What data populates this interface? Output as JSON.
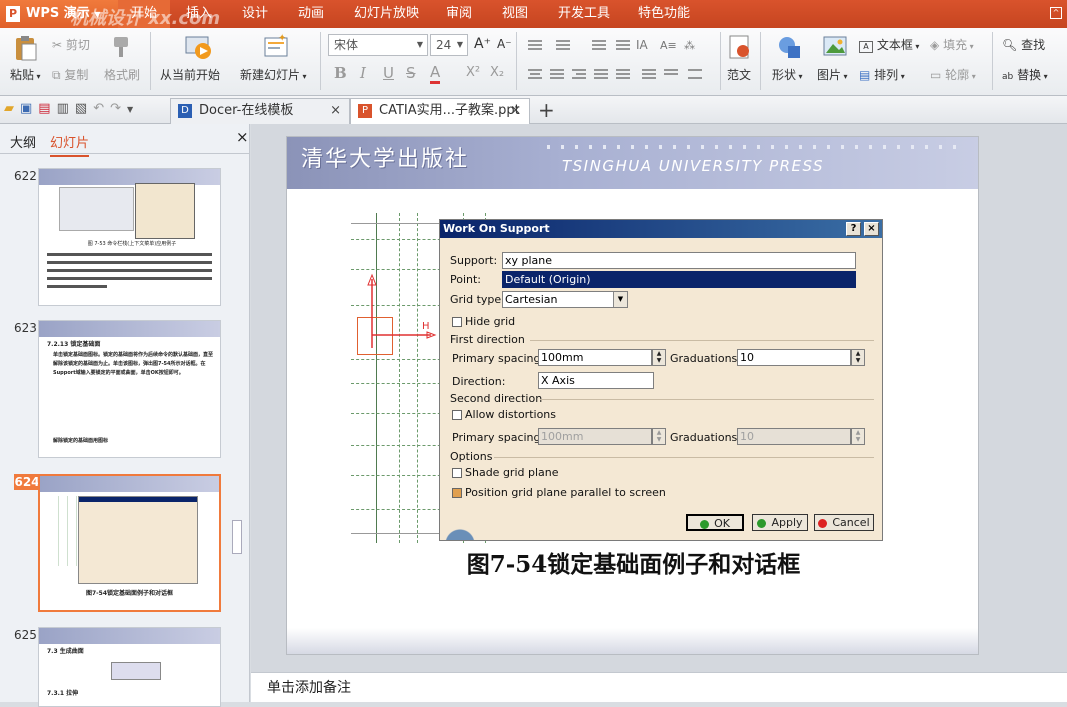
{
  "menubar": {
    "app_button": "WPS 演示",
    "watermark": "机械设计 xx.com",
    "tabs": [
      "开始",
      "插入",
      "设计",
      "动画",
      "幻灯片放映",
      "审阅",
      "视图",
      "开发工具",
      "特色功能"
    ]
  },
  "ribbon": {
    "paste": "粘贴",
    "cut": "剪切",
    "copy": "复制",
    "format_painter": "格式刷",
    "from_current": "从当前开始",
    "new_slide": "新建幻灯片",
    "font_name": "宋体",
    "font_size": "24",
    "font_grow": "A⁺",
    "font_shrink": "A⁻",
    "bold": "B",
    "italic": "I",
    "underline": "U",
    "strike": "S",
    "font_color": "A",
    "superscript": "X²",
    "subscript": "X₂",
    "template": "范文",
    "shape": "形状",
    "picture": "图片",
    "textbox": "文本框",
    "arrange": "排列",
    "fill": "填充",
    "outline": "轮廓",
    "find": "查找",
    "replace": "替换"
  },
  "doctabs": {
    "tab1": "Docer-在线模板",
    "tab2": "CATIA实用...子教案.ppt",
    "close": "×",
    "add": "+"
  },
  "leftpanel": {
    "tab_outline": "大纲",
    "tab_slides": "幻灯片",
    "close": "×",
    "slides": [
      {
        "num": "622",
        "caption": "图 7-53 命令栏栈(上下文菜单)应用例子"
      },
      {
        "num": "623",
        "heading": "7.2.13 锁定基础面",
        "body": "单击锁定基础面图标。锁定的基础面将作为后续命令的默认基础面，直至解除该锁定的基础面为止。单击该图标，弹出图7-54所示对话框。在Support域输入要锁定的平面或曲面，单击OK按钮即可。",
        "tail": "解除锁定的基础面用图标"
      },
      {
        "num": "624",
        "caption": "图7-54锁定基础面例子和对话框"
      },
      {
        "num": "625",
        "heading": "7.3 生成曲面",
        "sub": "7.3.1 拉伸"
      }
    ]
  },
  "slide": {
    "banner_cn": "清华大学出版社",
    "banner_en": "TSINGHUA UNIVERSITY PRESS",
    "caption": "图7-54锁定基础面例子和对话框",
    "axis_label": "H"
  },
  "dialog": {
    "title": "Work On Support",
    "help": "?",
    "close": "×",
    "support_label": "Support:",
    "support_value": "xy plane",
    "point_label": "Point:",
    "point_value": "Default (Origin)",
    "grid_type_label": "Grid type:",
    "grid_type_value": "Cartesian",
    "hide_grid": "Hide grid",
    "first_direction": "First direction",
    "primary_spacing_label": "Primary spacing:",
    "primary_spacing_1": "100mm",
    "graduations_label": "Graduations:",
    "graduations_1": "10",
    "direction_label": "Direction:",
    "direction_value": "X Axis",
    "second_direction": "Second direction",
    "allow_distortions": "Allow distortions",
    "primary_spacing_2": "100mm",
    "graduations_2": "10",
    "options": "Options",
    "shade_grid_plane": "Shade grid plane",
    "position_grid": "Position grid plane parallel to screen",
    "ok": "OK",
    "apply": "Apply",
    "cancel": "Cancel"
  },
  "notes": {
    "placeholder": "单击添加备注"
  }
}
